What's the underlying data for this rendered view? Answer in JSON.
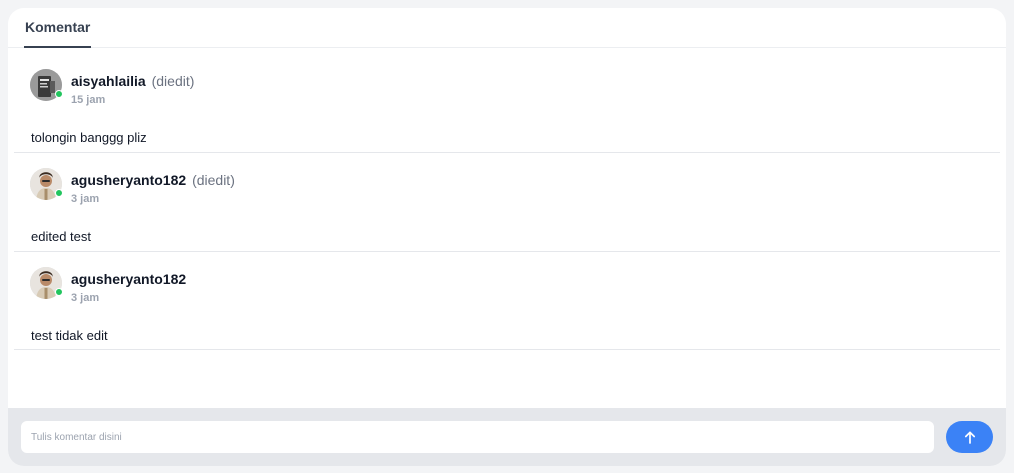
{
  "tabs": {
    "active": "Komentar"
  },
  "comments": [
    {
      "username": "aisyahlailia",
      "edited_label": "(diedit)",
      "time": "15 jam",
      "text": "tolongin banggg pliz",
      "online": true
    },
    {
      "username": "agusheryanto182",
      "edited_label": "(diedit)",
      "time": "3 jam",
      "text": "edited test",
      "online": true
    },
    {
      "username": "agusheryanto182",
      "edited_label": "",
      "time": "3 jam",
      "text": "test tidak edit",
      "online": true
    }
  ],
  "composer": {
    "placeholder": "Tulis komentar disini",
    "value": ""
  },
  "colors": {
    "accent": "#3b82f6",
    "online": "#22c55e"
  },
  "icons": {
    "send": "arrow-up-icon",
    "status": "online-dot"
  }
}
